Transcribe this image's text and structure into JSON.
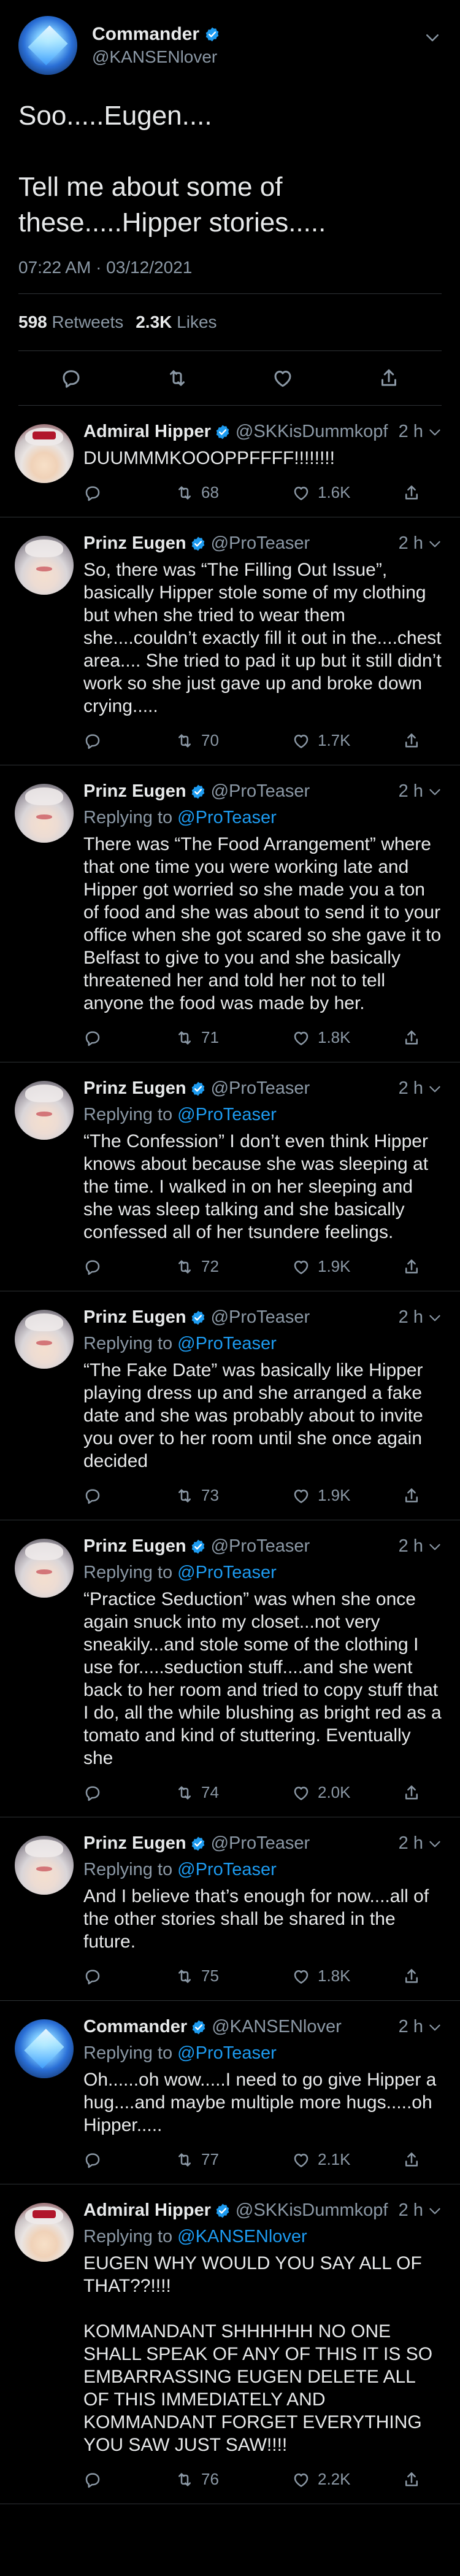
{
  "main_tweet": {
    "author_name": "Commander",
    "author_handle": "@KANSENlover",
    "text": "Soo.....Eugen....\n\nTell me about some of these.....Hipper stories.....",
    "timestamp": "07:22 AM · 03/12/2021",
    "retweets_count": "598",
    "retweets_label": "Retweets",
    "likes_count": "2.3K",
    "likes_label": "Likes"
  },
  "colors": {
    "background": "#000000",
    "text": "#e7e9ea",
    "secondary": "#8b98a5",
    "link": "#1d9bf0",
    "verified": "#1d9bf0",
    "divider": "#2f3336"
  },
  "replies": [
    {
      "name": "Admiral Hipper",
      "handle": "@SKKisDummkopf",
      "time": "2 h",
      "replying_to_label": "",
      "replying_to": "",
      "text": "DUUMMMKOOOPPFFFF!!!!!!!!",
      "retweets": "68",
      "likes": "1.6K",
      "avatar": "hipper"
    },
    {
      "name": "Prinz Eugen",
      "handle": "@ProTeaser",
      "time": "2 h",
      "replying_to_label": "",
      "replying_to": "",
      "text": "So, there was “The Filling Out Issue”, basically Hipper stole some of my clothing but when she tried to wear them she....couldn’t exactly fill it out in the....chest area.... She tried to pad it up but it still didn’t work so she just gave up and broke down crying.....",
      "retweets": "70",
      "likes": "1.7K",
      "avatar": "eugen"
    },
    {
      "name": "Prinz Eugen",
      "handle": "@ProTeaser",
      "time": "2 h",
      "replying_to_label": "Replying to",
      "replying_to": "@ProTeaser",
      "text": "There was “The Food Arrangement” where that one time you were working late and Hipper got worried so she made you a ton of food and she was about to send it to your office when she got scared so she gave it to Belfast to give to you and she basically threatened her and told her not to tell anyone the food was made by her.",
      "retweets": "71",
      "likes": "1.8K",
      "avatar": "eugen"
    },
    {
      "name": "Prinz Eugen",
      "handle": "@ProTeaser",
      "time": "2 h",
      "replying_to_label": "Replying to",
      "replying_to": "@ProTeaser",
      "text": "“The Confession” I don’t even think Hipper knows about because she was sleeping at the time. I walked in on her sleeping and she was sleep talking and she basically confessed all of her tsundere feelings.",
      "retweets": "72",
      "likes": "1.9K",
      "avatar": "eugen"
    },
    {
      "name": "Prinz Eugen",
      "handle": "@ProTeaser",
      "time": "2 h",
      "replying_to_label": "Replying to",
      "replying_to": "@ProTeaser",
      "text": "“The Fake Date” was basically like Hipper playing dress up and she arranged a fake date and she was probably about to invite you over to her room until she once again decided",
      "retweets": "73",
      "likes": "1.9K",
      "avatar": "eugen"
    },
    {
      "name": "Prinz Eugen",
      "handle": "@ProTeaser",
      "time": "2 h",
      "replying_to_label": "Replying to",
      "replying_to": "@ProTeaser",
      "text": "“Practice Seduction” was when she once again snuck into my closet...not very sneakily...and stole some of the clothing I use for.....seduction stuff....and she went back to her room and tried to copy stuff that I do, all the while blushing as bright red as a tomato and kind of stuttering. Eventually she",
      "retweets": "74",
      "likes": "2.0K",
      "avatar": "eugen"
    },
    {
      "name": "Prinz Eugen",
      "handle": "@ProTeaser",
      "time": "2 h",
      "replying_to_label": "Replying to",
      "replying_to": "@ProTeaser",
      "text": "And I believe that’s enough for now....all of the other stories shall be shared in the future.",
      "retweets": "75",
      "likes": "1.8K",
      "avatar": "eugen"
    },
    {
      "name": "Commander",
      "handle": "@KANSENlover",
      "time": "2 h",
      "replying_to_label": "Replying to",
      "replying_to": "@ProTeaser",
      "text": "Oh......oh wow.....I need to go give Hipper a hug....and maybe multiple more hugs.....oh Hipper.....",
      "retweets": "77",
      "likes": "2.1K",
      "avatar": "commander"
    },
    {
      "name": "Admiral Hipper",
      "handle": "@SKKisDummkopf",
      "time": "2 h",
      "replying_to_label": "Replying to",
      "replying_to": "@KANSENlover",
      "text": "EUGEN WHY WOULD YOU SAY ALL OF THAT??!!!!\n\nKOMMANDANT SHHHHHH NO ONE SHALL SPEAK OF ANY OF THIS IT IS SO EMBARRASSING EUGEN DELETE ALL OF THIS IMMEDIATELY AND KOMMANDANT FORGET EVERYTHING YOU SAW JUST SAW!!!!",
      "retweets": "76",
      "likes": "2.2K",
      "avatar": "hipper"
    }
  ]
}
